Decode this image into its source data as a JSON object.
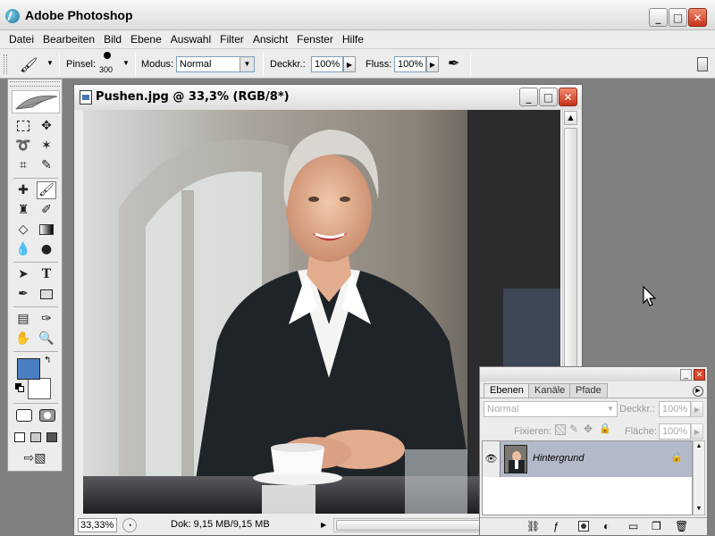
{
  "app": {
    "title": "Adobe Photoshop",
    "window_buttons": {
      "minimize": "_",
      "maximize": "□",
      "close": "✕"
    }
  },
  "menu": [
    "Datei",
    "Bearbeiten",
    "Bild",
    "Ebene",
    "Auswahl",
    "Filter",
    "Ansicht",
    "Fenster",
    "Hilfe"
  ],
  "options": {
    "brush_label": "Pinsel:",
    "brush_size": "300",
    "mode_label": "Modus:",
    "mode_value": "Normal",
    "opacity_label": "Deckkr.:",
    "opacity_value": "100%",
    "flow_label": "Fluss:",
    "flow_value": "100%"
  },
  "document": {
    "title": "Pushen.jpg @ 33,3% (RGB/8*)",
    "zoom": "33,33%",
    "doc_size": "Dok: 9,15 MB/9,15 MB"
  },
  "colors": {
    "foreground": "#4a7fc1",
    "background": "#ffffff",
    "accent": "#d9472a"
  },
  "layers_panel": {
    "tabs": [
      "Ebenen",
      "Kanäle",
      "Pfade"
    ],
    "blend_mode": "Normal",
    "opacity_label": "Deckkr.:",
    "opacity_value": "100%",
    "lock_label": "Fixieren:",
    "fill_label": "Fläche:",
    "fill_value": "100%",
    "layers": [
      {
        "name": "Hintergrund",
        "visible": true,
        "locked": true
      }
    ]
  }
}
